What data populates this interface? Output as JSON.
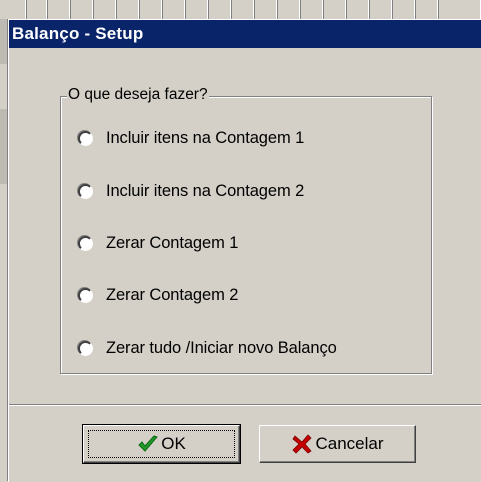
{
  "window": {
    "title": "Balanço - Setup"
  },
  "group": {
    "caption": "O que deseja fazer?",
    "options": [
      {
        "label": "Incluir itens na Contagem 1",
        "selected": false
      },
      {
        "label": "Incluir itens na Contagem 2",
        "selected": false
      },
      {
        "label": "Zerar Contagem 1",
        "selected": false
      },
      {
        "label": "Zerar Contagem 2",
        "selected": false
      },
      {
        "label": "Zerar tudo /Iniciar novo Balanço",
        "selected": false
      }
    ]
  },
  "buttons": {
    "ok_label": "OK",
    "ok_icon": "checkmark-icon",
    "cancel_label": "Cancelar",
    "cancel_icon": "red-x-icon"
  },
  "colors": {
    "title_bar": "#0a246a",
    "dialog_bg": "#d4d0c8",
    "check_green": "#1f9a2a",
    "x_red": "#c40000"
  }
}
